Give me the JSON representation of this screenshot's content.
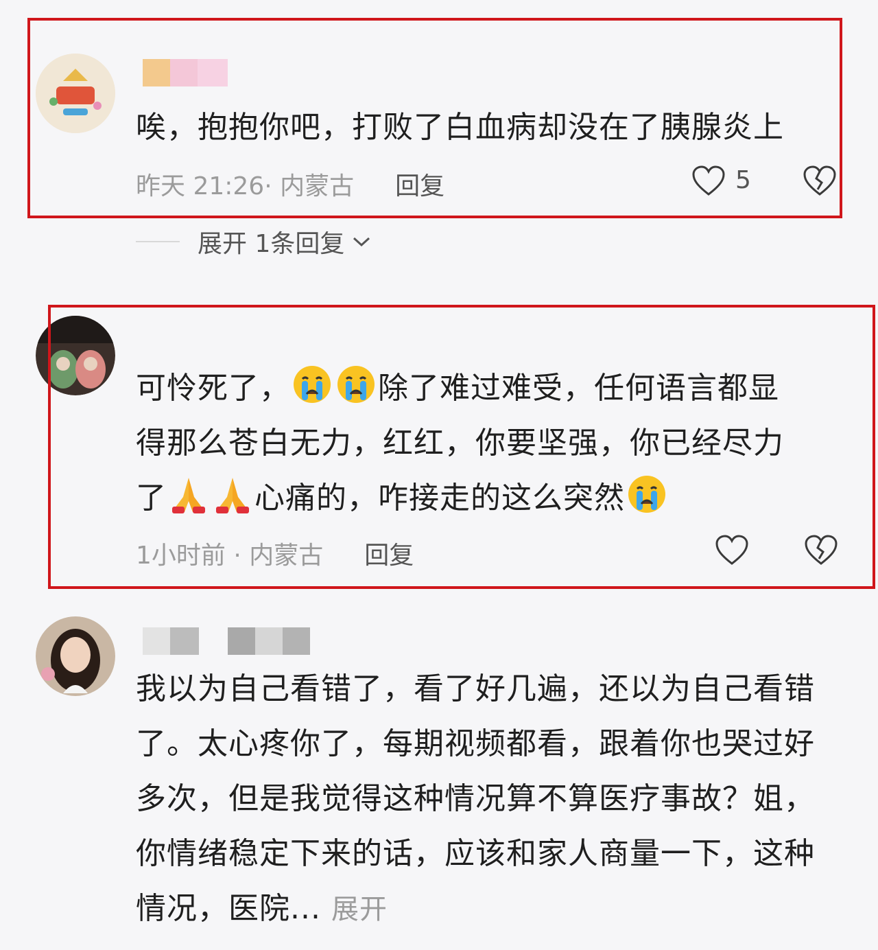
{
  "comments": [
    {
      "text": "唉，抱抱你吧，打败了白血病却没在了胰腺炎上",
      "time_location": "昨天 21:26· 内蒙古",
      "reply_label": "回复",
      "like_count": "5",
      "expand_replies": "展开 1条回复"
    },
    {
      "text_line1a": "可怜死了，",
      "text_line1b": "除了难过难受，任何语言都显",
      "text_line2": "得那么苍白无力，红红，你要坚强，你已经尽力",
      "text_line3a": "了",
      "text_line3b": "心痛的，咋接走的这么突然",
      "time_location": "1小时前 · 内蒙古",
      "reply_label": "回复"
    },
    {
      "text": "我以为自己看错了，看了好几遍，还以为自己看错了。太心疼你了，每期视频都看，跟着你也哭过好多次，但是我觉得这种情况算不算医疗事故？姐，你情绪稳定下来的话，应该和家人商量一下，这种情况，医院...",
      "more_label": "展开"
    }
  ],
  "icons": [
    "heart-icon",
    "broken-heart-icon",
    "chevron-down-icon",
    "crying-face-icon",
    "praying-hands-icon"
  ],
  "colors": {
    "highlight_box": "#d0161b",
    "meta_text": "#9b9b9b",
    "background": "#f6f6f8"
  }
}
